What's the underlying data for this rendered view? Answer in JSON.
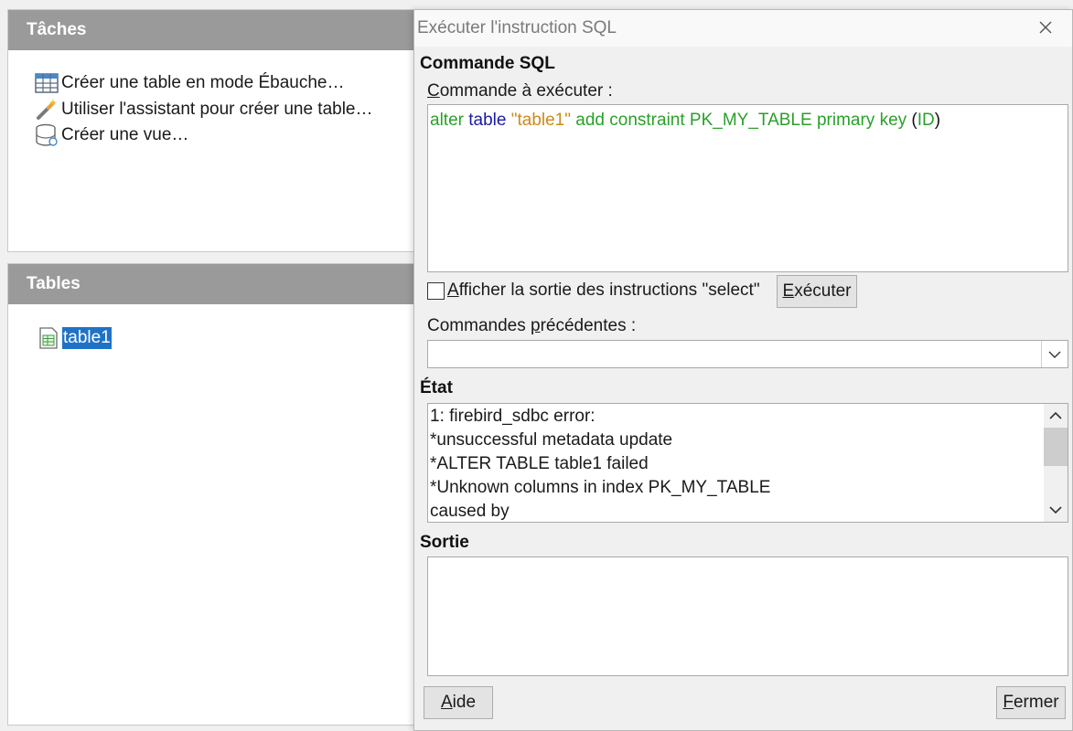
{
  "tasks_panel": {
    "header": "Tâches",
    "items": [
      {
        "label": "Créer une table en mode Ébauche…",
        "icon": "table-design-icon"
      },
      {
        "label": "Utiliser l'assistant pour créer une table…",
        "icon": "wizard-icon"
      },
      {
        "label": "Créer une vue…",
        "icon": "database-view-icon"
      }
    ]
  },
  "tables_panel": {
    "header": "Tables",
    "items": [
      {
        "label": "table1",
        "icon": "table-icon",
        "selected": true
      }
    ]
  },
  "dialog": {
    "title": "Exécuter l'instruction SQL",
    "sql_section": "Commande SQL",
    "command_label_first": "C",
    "command_label_rest": "ommande à exécuter :",
    "sql_tokens": [
      {
        "text": "alter ",
        "color": "green"
      },
      {
        "text": "table",
        "color": "blue"
      },
      {
        "text": " ",
        "color": "black"
      },
      {
        "text": "\"table1\"",
        "color": "orange"
      },
      {
        "text": " add constraint PK_MY_TABLE primary key ",
        "color": "green"
      },
      {
        "text": "(",
        "color": "black"
      },
      {
        "text": "ID",
        "color": "green"
      },
      {
        "text": ")",
        "color": "black"
      }
    ],
    "show_select_first": "A",
    "show_select_rest": "fficher la sortie des instructions \"select\"",
    "show_select_checked": false,
    "execute_first": "E",
    "execute_rest": "xécuter",
    "previous_label_pre": "Commandes ",
    "previous_label_u": "p",
    "previous_label_post": "récédentes :",
    "previous_value": "",
    "status_section": "État",
    "status_lines": [
      "1: firebird_sdbc error:",
      "*unsuccessful metadata update",
      "*ALTER TABLE table1 failed",
      "*Unknown columns in index PK_MY_TABLE",
      "caused by"
    ],
    "output_section": "Sortie",
    "output_text": "",
    "help_first": "A",
    "help_rest": "ide",
    "close_first": "F",
    "close_rest": "ermer"
  },
  "colors": {
    "panel_header_bg": "#9a9a9a",
    "selection_bg": "#1f73c7",
    "sql_keyword_green": "#2aa02a",
    "sql_keyword_blue": "#1a1aa8",
    "sql_string_orange": "#cc8a1a"
  }
}
